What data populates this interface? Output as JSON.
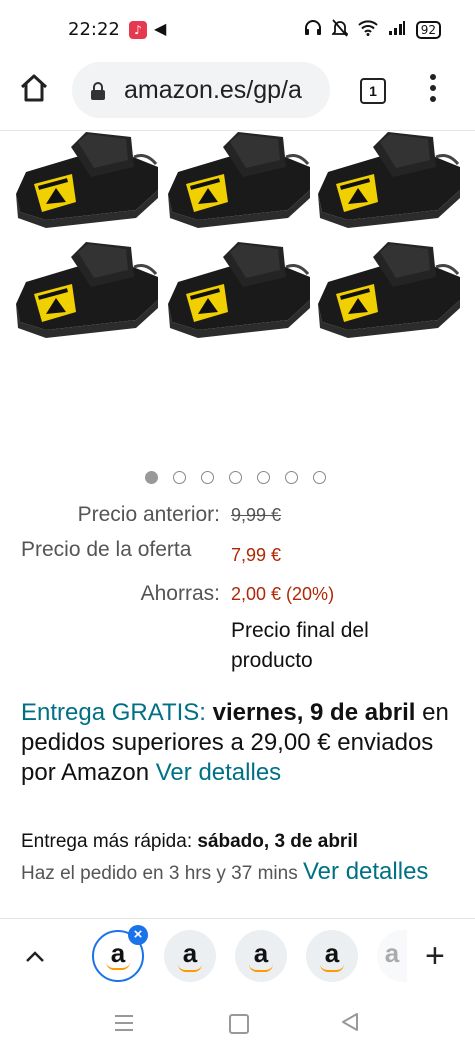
{
  "status_bar": {
    "time": "22:22",
    "battery": "92",
    "icons": [
      "music-app-icon",
      "volume-icon",
      "headset-icon",
      "mute-icon",
      "wifi-icon",
      "signal-icon",
      "battery-icon"
    ]
  },
  "browser": {
    "url": "amazon.es/gp/a",
    "tab_count": "1"
  },
  "product_gallery": {
    "image_count": 7,
    "active_index": 0,
    "icons": [
      "mouse-trap-image"
    ]
  },
  "pricing": {
    "previous_label": "Precio anterior:",
    "previous_value": "9,99 €",
    "offer_label": "Precio de la oferta",
    "offer_value": "7,99 €",
    "savings_label": "Ahorras:",
    "savings_value": "2,00 € (20%)",
    "final_note": "Precio final del producto"
  },
  "delivery": {
    "free_label": "Entrega GRATIS:",
    "date": "viernes, 9 de abril",
    "condition": "en pedidos superiores a 29,00 € enviados por Amazon",
    "details_link": "Ver detalles"
  },
  "fast_delivery": {
    "label": "Entrega más rápida:",
    "date": "sábado, 3 de abril",
    "order_within": "Haz el pedido en 3 hrs y 37 mins",
    "details_link": "Ver detalles"
  },
  "tab_strip": {
    "tab_letter": "a",
    "close_symbol": "×",
    "add_symbol": "+",
    "collapse_symbol": "^"
  },
  "colors": {
    "accent_teal": "#007185",
    "price_red": "#b12704",
    "amazon_orange": "#ff9900",
    "chrome_blue": "#1a73e8"
  }
}
